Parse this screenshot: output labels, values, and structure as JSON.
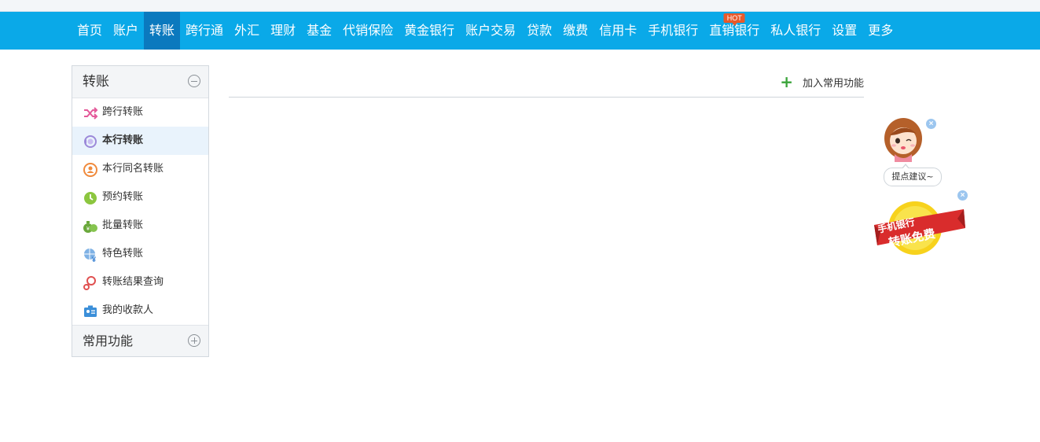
{
  "nav": {
    "items": [
      {
        "label": "首页",
        "active": false
      },
      {
        "label": "账户",
        "active": false
      },
      {
        "label": "转账",
        "active": true
      },
      {
        "label": "跨行通",
        "active": false
      },
      {
        "label": "外汇",
        "active": false
      },
      {
        "label": "理财",
        "active": false
      },
      {
        "label": "基金",
        "active": false
      },
      {
        "label": "代销保险",
        "active": false
      },
      {
        "label": "黄金银行",
        "active": false
      },
      {
        "label": "账户交易",
        "active": false
      },
      {
        "label": "贷款",
        "active": false
      },
      {
        "label": "缴费",
        "active": false
      },
      {
        "label": "信用卡",
        "active": false
      },
      {
        "label": "手机银行",
        "active": false
      },
      {
        "label": "直销银行",
        "active": false,
        "badge": "HOT"
      },
      {
        "label": "私人银行",
        "active": false
      },
      {
        "label": "设置",
        "active": false
      },
      {
        "label": "更多",
        "active": false
      }
    ]
  },
  "sidebar": {
    "title": "转账",
    "items": [
      {
        "label": "跨行转账",
        "icon": "shuffle-icon",
        "active": false
      },
      {
        "label": "本行转账",
        "icon": "exchange-icon",
        "active": true
      },
      {
        "label": "本行同名转账",
        "icon": "user-transfer-icon",
        "active": false
      },
      {
        "label": "预约转账",
        "icon": "clock-icon",
        "active": false
      },
      {
        "label": "批量转账",
        "icon": "money-bags-icon",
        "active": false
      },
      {
        "label": "特色转账",
        "icon": "globe-yen-icon",
        "active": false
      },
      {
        "label": "转账结果查询",
        "icon": "search-icon",
        "active": false
      },
      {
        "label": "我的收款人",
        "icon": "contact-card-icon",
        "active": false
      }
    ],
    "footer": "常用功能"
  },
  "content": {
    "add_common_label": "加入常用功能"
  },
  "float": {
    "suggest_label": "提点建议~",
    "promo_line1": "手机银行",
    "promo_line2": "转账免费"
  },
  "colors": {
    "nav_bg": "#0aa9e8",
    "nav_active": "#0b79be",
    "hot": "#e8592a",
    "plus": "#3aa43a"
  }
}
